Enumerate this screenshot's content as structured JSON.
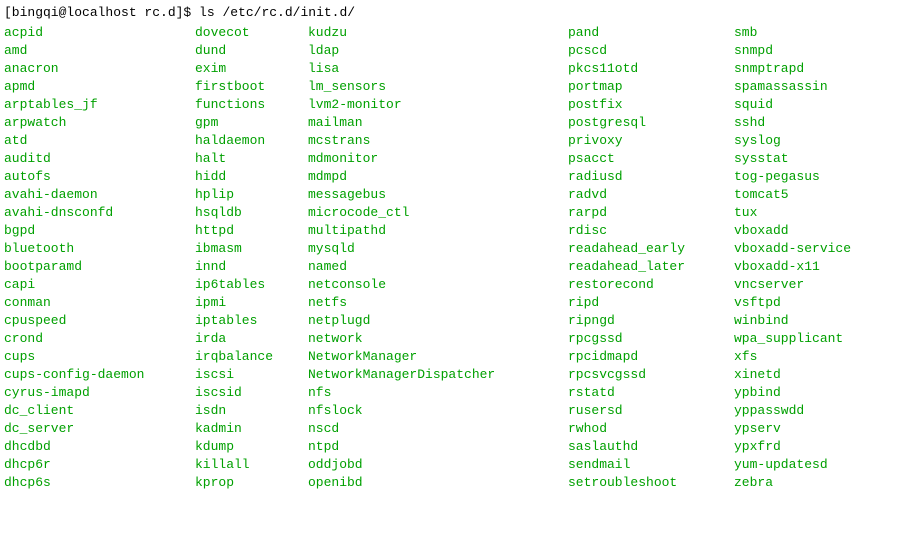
{
  "prompt": {
    "user_host_path": "[bingqi@localhost rc.d]$ ",
    "command": "ls /etc/rc.d/init.d/"
  },
  "columns": {
    "col1": [
      "acpid",
      "amd",
      "anacron",
      "apmd",
      "arptables_jf",
      "arpwatch",
      "atd",
      "auditd",
      "autofs",
      "avahi-daemon",
      "avahi-dnsconfd",
      "bgpd",
      "bluetooth",
      "bootparamd",
      "capi",
      "conman",
      "cpuspeed",
      "crond",
      "cups",
      "cups-config-daemon",
      "cyrus-imapd",
      "dc_client",
      "dc_server",
      "dhcdbd",
      "dhcp6r",
      "dhcp6s"
    ],
    "col2": [
      "dovecot",
      "dund",
      "exim",
      "firstboot",
      "functions",
      "gpm",
      "haldaemon",
      "halt",
      "hidd",
      "hplip",
      "hsqldb",
      "httpd",
      "ibmasm",
      "innd",
      "ip6tables",
      "ipmi",
      "iptables",
      "irda",
      "irqbalance",
      "iscsi",
      "iscsid",
      "isdn",
      "kadmin",
      "kdump",
      "killall",
      "kprop"
    ],
    "col3": [
      "kudzu",
      "ldap",
      "lisa",
      "lm_sensors",
      "lvm2-monitor",
      "mailman",
      "mcstrans",
      "mdmonitor",
      "mdmpd",
      "messagebus",
      "microcode_ctl",
      "multipathd",
      "mysqld",
      "named",
      "netconsole",
      "netfs",
      "netplugd",
      "network",
      "NetworkManager",
      "NetworkManagerDispatcher",
      "nfs",
      "nfslock",
      "nscd",
      "ntpd",
      "oddjobd",
      "openibd"
    ],
    "col4": [
      "pand",
      "pcscd",
      "pkcs11otd",
      "portmap",
      "postfix",
      "postgresql",
      "privoxy",
      "psacct",
      "radiusd",
      "radvd",
      "rarpd",
      "rdisc",
      "readahead_early",
      "readahead_later",
      "restorecond",
      "ripd",
      "ripngd",
      "rpcgssd",
      "rpcidmapd",
      "rpcsvcgssd",
      "rstatd",
      "rusersd",
      "rwhod",
      "saslauthd",
      "sendmail",
      "setroubleshoot"
    ],
    "col5": [
      "smb",
      "snmpd",
      "snmptrapd",
      "spamassassin",
      "squid",
      "sshd",
      "syslog",
      "sysstat",
      "tog-pegasus",
      "tomcat5",
      "tux",
      "vboxadd",
      "vboxadd-service",
      "vboxadd-x11",
      "vncserver",
      "vsftpd",
      "winbind",
      "wpa_supplicant",
      "xfs",
      "xinetd",
      "ypbind",
      "yppasswdd",
      "ypserv",
      "ypxfrd",
      "yum-updatesd",
      "zebra"
    ]
  }
}
